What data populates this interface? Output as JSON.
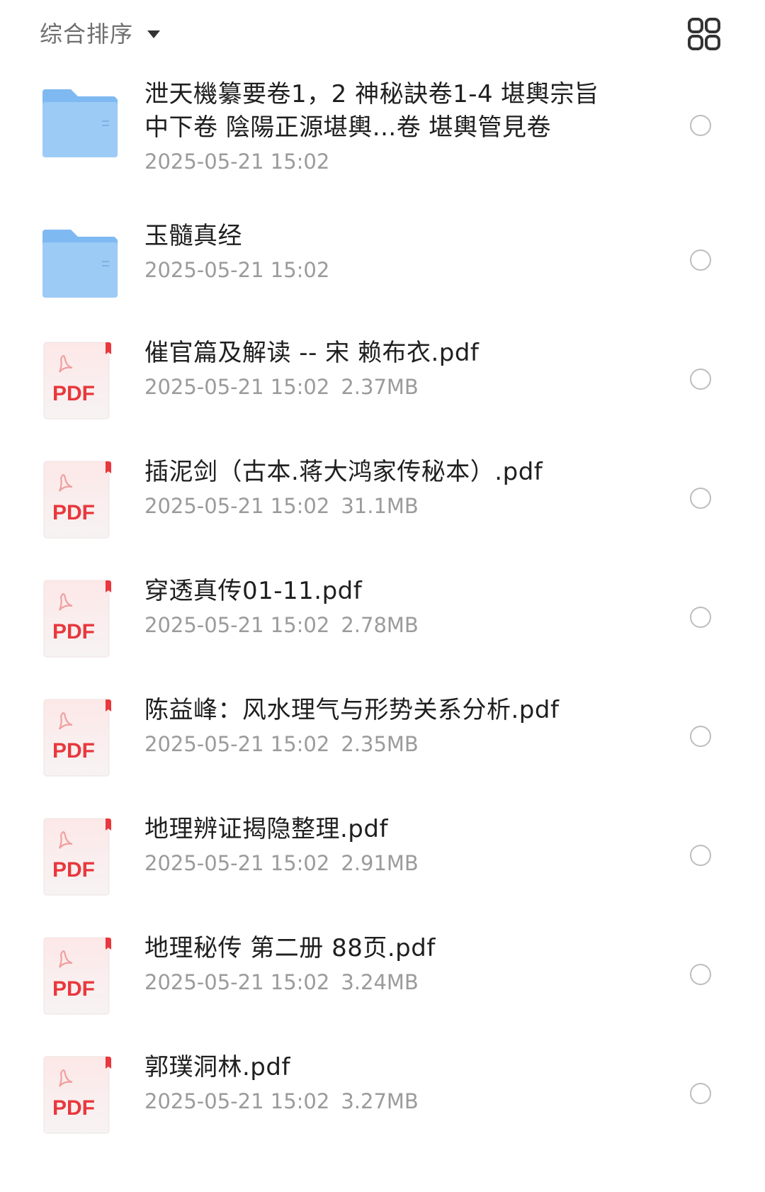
{
  "toolbar": {
    "sort_label": "综合排序",
    "sort_icon": "chevron-down-icon",
    "view_toggle_icon": "grid-view-icon"
  },
  "colors": {
    "folder": "#7fb9f2",
    "pdf_red": "#e8383d",
    "pdf_bg": "#fde8e8",
    "text_primary": "#1f1f1f",
    "text_secondary": "#9b9b9b"
  },
  "files": [
    {
      "type": "folder",
      "icon": "folder-icon",
      "name": "泄天機纂要卷1，2 神秘訣卷1-4 堪輿宗旨中下卷 陰陽正源堪輿...卷 堪輿管見卷",
      "date": "2025-05-21 15:02",
      "size": ""
    },
    {
      "type": "folder",
      "icon": "folder-icon",
      "name": "玉髓真经",
      "date": "2025-05-21 15:02",
      "size": ""
    },
    {
      "type": "pdf",
      "icon": "pdf-file-icon",
      "badge": "PDF",
      "name": "催官篇及解读 -- 宋 赖布衣.pdf",
      "date": "2025-05-21 15:02",
      "size": "2.37MB"
    },
    {
      "type": "pdf",
      "icon": "pdf-file-icon",
      "badge": "PDF",
      "name": "插泥剑（古本.蒋大鸿家传秘本）.pdf",
      "date": "2025-05-21 15:02",
      "size": "31.1MB"
    },
    {
      "type": "pdf",
      "icon": "pdf-file-icon",
      "badge": "PDF",
      "name": "穿透真传01-11.pdf",
      "date": "2025-05-21 15:02",
      "size": "2.78MB"
    },
    {
      "type": "pdf",
      "icon": "pdf-file-icon",
      "badge": "PDF",
      "name": "陈益峰：风水理气与形势关系分析.pdf",
      "date": "2025-05-21 15:02",
      "size": "2.35MB"
    },
    {
      "type": "pdf",
      "icon": "pdf-file-icon",
      "badge": "PDF",
      "name": "地理辨证揭隐整理.pdf",
      "date": "2025-05-21 15:02",
      "size": "2.91MB"
    },
    {
      "type": "pdf",
      "icon": "pdf-file-icon",
      "badge": "PDF",
      "name": "地理秘传 第二册 88页.pdf",
      "date": "2025-05-21 15:02",
      "size": "3.24MB"
    },
    {
      "type": "pdf",
      "icon": "pdf-file-icon",
      "badge": "PDF",
      "name": "郭璞洞林.pdf",
      "date": "2025-05-21 15:02",
      "size": "3.27MB"
    }
  ]
}
